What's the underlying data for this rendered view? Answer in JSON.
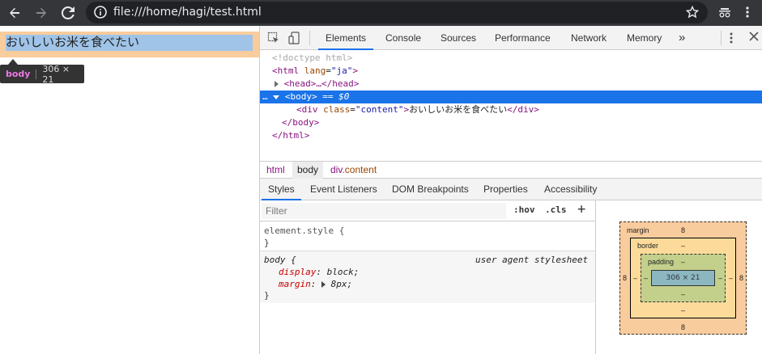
{
  "browser": {
    "url": "file:///home/hagi/test.html"
  },
  "page": {
    "content_text": "おいしいお米を食べたい",
    "tooltip_tag": "body",
    "tooltip_dims": "306 × 21"
  },
  "devtools": {
    "tabs": [
      "Elements",
      "Console",
      "Sources",
      "Performance",
      "Network",
      "Memory"
    ],
    "more_tabs": "»",
    "dom": {
      "doctype": "<!doctype html>",
      "html_open_tag": "html",
      "html_attr": "lang",
      "html_attr_val": "\"ja\"",
      "head_collapsed": "<head>…</head>",
      "body_tag": "<body>",
      "body_suffix": "== $0",
      "div_tag": "div",
      "div_attr": "class",
      "div_attr_val": "\"content\"",
      "div_text": "おいしいお米を食べたい",
      "div_close": "</div>",
      "body_close": "</body>",
      "html_close": "</html>",
      "ellipsis": "…"
    },
    "breadcrumbs": [
      {
        "tag": "html",
        "cls": ""
      },
      {
        "tag": "body",
        "cls": ""
      },
      {
        "tag": "div",
        "cls": ".content"
      }
    ],
    "sub_tabs": [
      "Styles",
      "Event Listeners",
      "DOM Breakpoints",
      "Properties",
      "Accessibility"
    ],
    "styles": {
      "filter_placeholder": "Filter",
      "hov": ":hov",
      "cls": ".cls",
      "plus": "+",
      "element_style_open": "element.style {",
      "close_brace": "}",
      "body_selector": "body {",
      "ua_label": "user agent stylesheet",
      "prop1_name": "display",
      "prop1_val": "block;",
      "prop2_name": "margin",
      "prop2_val": "8px;"
    },
    "box_model": {
      "margin_label": "margin",
      "margin_top": "8",
      "margin_bottom": "8",
      "margin_left": "8",
      "margin_right": "8",
      "border_label": "border",
      "border_top": "–",
      "border_bottom": "–",
      "border_left": "–",
      "border_right": "–",
      "padding_label": "padding",
      "padding_top": "–",
      "padding_bottom": "–",
      "padding_left": "–",
      "padding_right": "–",
      "content_dims": "306 × 21"
    }
  }
}
